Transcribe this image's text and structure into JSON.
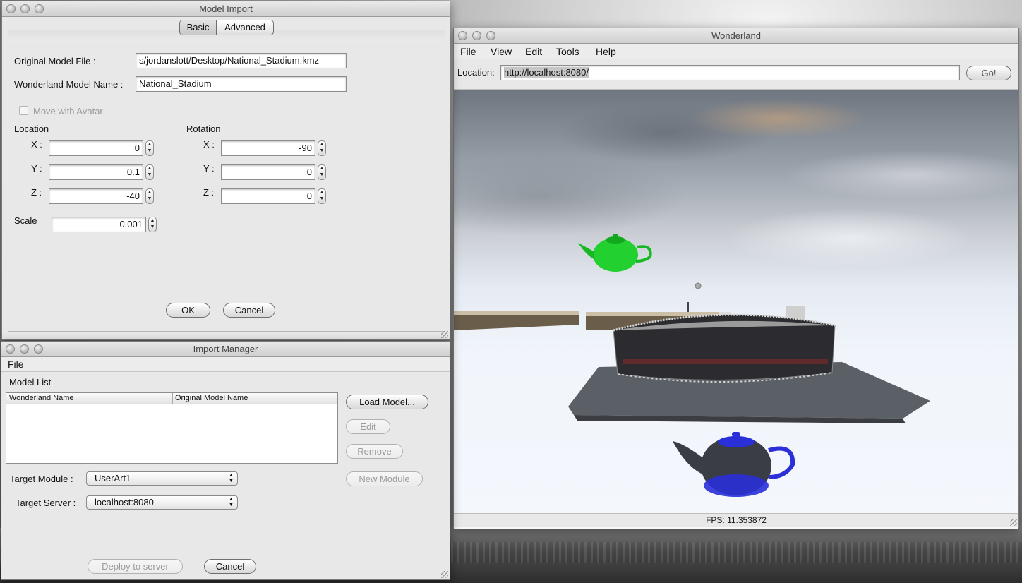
{
  "model_import": {
    "title": "Model Import",
    "tabs": [
      {
        "label": "Basic",
        "selected": true
      },
      {
        "label": "Advanced",
        "selected": false
      }
    ],
    "original_model_file_label": "Original Model File :",
    "original_model_file_value": "s/jordanslott/Desktop/National_Stadium.kmz",
    "wonderland_model_name_label": "Wonderland Model Name :",
    "wonderland_model_name_value": "National_Stadium",
    "move_with_avatar_label": "Move with Avatar",
    "location_label": "Location",
    "rotation_label": "Rotation",
    "x_label": "X :",
    "y_label": "Y :",
    "z_label": "Z :",
    "location": {
      "x": "0",
      "y": "0.1",
      "z": "-40"
    },
    "rotation": {
      "x": "-90",
      "y": "0",
      "z": "0"
    },
    "scale_label": "Scale",
    "scale_value": "0.001",
    "ok_label": "OK",
    "cancel_label": "Cancel"
  },
  "import_manager": {
    "title": "Import Manager",
    "menu_file": "File",
    "model_list_label": "Model List",
    "columns": [
      "Wonderland Name",
      "Original Model Name"
    ],
    "load_model_label": "Load Model...",
    "edit_label": "Edit",
    "remove_label": "Remove",
    "new_module_label": "New Module",
    "target_module_label": "Target Module :",
    "target_module_value": "UserArt1",
    "target_server_label": "Target Server :",
    "target_server_value": "localhost:8080",
    "deploy_label": "Deploy to server",
    "cancel_label": "Cancel"
  },
  "wonderland": {
    "title": "Wonderland",
    "menu": [
      "File",
      "View",
      "Edit",
      "Tools",
      "Help"
    ],
    "location_label": "Location:",
    "location_value": "http://localhost:8080/",
    "go_label": "Go!",
    "fps_text": "FPS: 11.353872"
  },
  "colors": {
    "teapot_green": "#22d030",
    "teapot_blue": "#2a2fd8",
    "window_bg": "#e8e8e8"
  }
}
